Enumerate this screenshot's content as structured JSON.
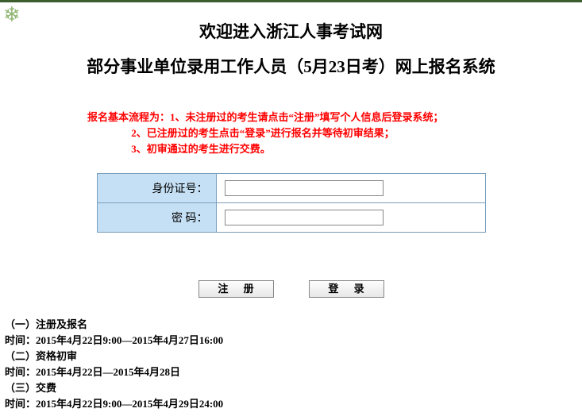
{
  "header": {
    "title_main": "欢迎进入浙江人事考试网",
    "title_sub": "部分事业单位录用工作人员（5月23日考）网上报名系统"
  },
  "notice": {
    "prefix": "报名基本流程为：",
    "line1": "1、未注册过的考生请点击“注册”填写个人信息后登录系统；",
    "line2": "2、已注册过的考生点击“登录”进行报名并等待初审结果；",
    "line3": "3、初审通过的考生进行交费。"
  },
  "form": {
    "id_label": "身份证号：",
    "pw_label": "密  码：",
    "id_value": "",
    "pw_value": ""
  },
  "buttons": {
    "register": "注 册",
    "login": "登 录"
  },
  "schedule": {
    "s1_title": "（一）注册及报名",
    "s1_time": "时间：2015年4月22日9:00—2015年4月27日16:00",
    "s2_title": "（二）资格初审",
    "s2_time": "时间：2015年4月22日—2015年4月28日",
    "s3_title": "（三）交费",
    "s3_time": "时间：2015年4月22日9:00—2015年4月29日24:00"
  }
}
